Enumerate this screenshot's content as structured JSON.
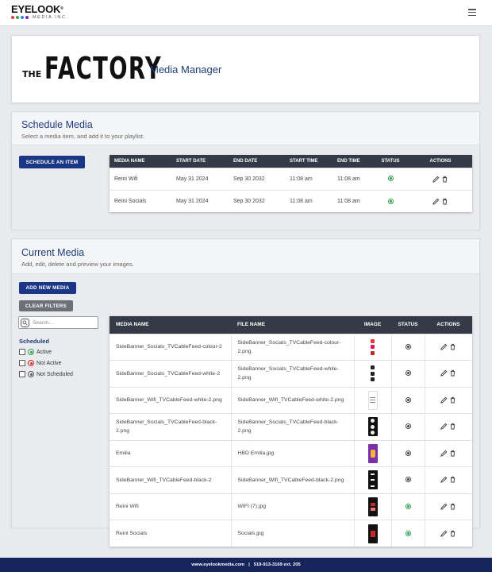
{
  "brand": {
    "name": "EYELOOK",
    "trademark": "®",
    "tagline": "MEDIA INC.",
    "dot_colors": [
      "#e53935",
      "#43a047",
      "#1e88e5",
      "#8e24aa"
    ]
  },
  "header": {
    "client_logo_the": "THE",
    "client_logo_word": "FACTORY",
    "title": "Media Manager"
  },
  "schedule": {
    "title": "Schedule Media",
    "subtitle": "Select a media item, and add it to your playlist.",
    "button_label": "SCHEDULE AN ITEM",
    "columns": [
      "MEDIA NAME",
      "START DATE",
      "END DATE",
      "START TIME",
      "END TIME",
      "STATUS",
      "ACTIONS"
    ],
    "rows": [
      {
        "name": "Reini Wifi",
        "start_date": "May 31 2024",
        "end_date": "Sep 30 2032",
        "start_time": "11:08 am",
        "end_time": "11:08 am",
        "status": "active"
      },
      {
        "name": "Reini Socials",
        "start_date": "May 31 2024",
        "end_date": "Sep 30 2032",
        "start_time": "11:08 am",
        "end_time": "11:08 am",
        "status": "active"
      }
    ]
  },
  "current": {
    "title": "Current Media",
    "subtitle": "Add, edit, delete and preview your images.",
    "add_button": "ADD NEW MEDIA",
    "clear_button": "CLEAR FILTERS",
    "search_placeholder": "Search...",
    "filter_title": "Scheduled",
    "filters": [
      {
        "label": "Active",
        "color": "green"
      },
      {
        "label": "Not Active",
        "color": "red"
      },
      {
        "label": "Not Scheduled",
        "color": "gray"
      }
    ],
    "columns": [
      "MEDIA NAME",
      "FILE NAME",
      "IMAGE",
      "STATUS",
      "ACTIONS"
    ],
    "rows": [
      {
        "name": "SideBanner_Socials_TVCableFeed-colour-2",
        "file": "SideBanner_Socials_TVCableFeed-colour-2.png",
        "thumb": "social-colour-icon",
        "status": "not-scheduled"
      },
      {
        "name": "SideBanner_Socials_TVCableFeed-white-2",
        "file": "SideBanner_Socials_TVCableFeed-white-2.png",
        "thumb": "social-mono-icon",
        "status": "not-scheduled"
      },
      {
        "name": "SideBanner_Wifi_TVCableFeed-white-2.png",
        "file": "SideBanner_Wifi_TVCableFeed-white-2.png",
        "thumb": "wifi-white-icon",
        "status": "not-scheduled"
      },
      {
        "name": "SideBanner_Socials_TVCableFeed-black-2.png",
        "file": "SideBanner_Socials_TVCableFeed-black-2.png",
        "thumb": "social-dark-icon",
        "status": "not-scheduled"
      },
      {
        "name": "Emilia",
        "file": "HBD Emilia.jpg",
        "thumb": "birthday-icon",
        "status": "not-scheduled"
      },
      {
        "name": "SideBanner_Wifi_TVCableFeed-black-2",
        "file": "SideBanner_Wifi_TVCableFeed-black-2.png",
        "thumb": "wifi-dark-icon",
        "status": "not-scheduled"
      },
      {
        "name": "Reini Wifi",
        "file": "WIFI (7).jpg",
        "thumb": "wifi-red-icon",
        "status": "active"
      },
      {
        "name": "Reini Socials",
        "file": "Socials.jpg",
        "thumb": "socials-red-icon",
        "status": "active"
      }
    ]
  },
  "footer": {
    "site": "www.eyelookmedia.com",
    "separator": "|",
    "phone": "519-913-3169 ext. 205"
  }
}
